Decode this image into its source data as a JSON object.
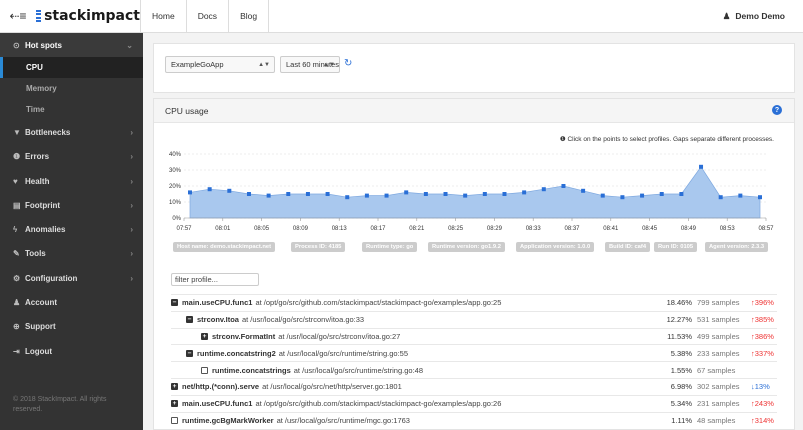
{
  "topbar": {
    "nav": [
      "Home",
      "Docs",
      "Blog"
    ],
    "user": "Demo Demo",
    "logo": "stackimpact"
  },
  "sidebar": {
    "items": [
      {
        "label": "Hot spots",
        "icon": "⊙",
        "open": true
      },
      {
        "label": "Bottlenecks",
        "icon": "▼"
      },
      {
        "label": "Errors",
        "icon": "❶"
      },
      {
        "label": "Health",
        "icon": "♥"
      },
      {
        "label": "Footprint",
        "icon": "▤"
      },
      {
        "label": "Anomalies",
        "icon": "ϟ"
      },
      {
        "label": "Tools",
        "icon": "✎"
      },
      {
        "label": "Configuration",
        "icon": "⚙"
      },
      {
        "label": "Account",
        "icon": "♟"
      },
      {
        "label": "Support",
        "icon": "⊕"
      },
      {
        "label": "Logout",
        "icon": "⇥"
      }
    ],
    "subitems": [
      "CPU",
      "Memory",
      "Time"
    ],
    "footer": "© 2018 StackImpact. All rights reserved."
  },
  "selectors": {
    "app": "ExampleGoApp",
    "range": "Last 60 minutes"
  },
  "panel": {
    "title": "CPU usage",
    "hint": "❶ Click on the points to select profiles. Gaps separate different processes."
  },
  "chart_data": {
    "type": "area",
    "x": [
      "07:57",
      "07:59",
      "08:01",
      "08:03",
      "08:05",
      "08:07",
      "08:09",
      "08:11",
      "08:13",
      "08:15",
      "08:17",
      "08:19",
      "08:21",
      "08:23",
      "08:25",
      "08:27",
      "08:29",
      "08:31",
      "08:33",
      "08:35",
      "08:37",
      "08:39",
      "08:41",
      "08:43",
      "08:45",
      "08:47",
      "08:49",
      "08:51",
      "08:53",
      "08:55"
    ],
    "values": [
      16,
      18,
      17,
      15,
      14,
      15,
      15,
      15,
      13,
      14,
      14,
      16,
      15,
      15,
      14,
      15,
      15,
      16,
      18,
      20,
      17,
      14,
      13,
      14,
      15,
      15,
      32,
      13,
      14,
      13
    ],
    "xticks": [
      "07:57",
      "08:01",
      "08:05",
      "08:09",
      "08:13",
      "08:17",
      "08:21",
      "08:25",
      "08:29",
      "08:33",
      "08:37",
      "08:41",
      "08:45",
      "08:49",
      "08:53",
      "08:57"
    ],
    "yticks": [
      "0%",
      "10%",
      "20%",
      "30%",
      "40%"
    ],
    "ylim": [
      0,
      40
    ],
    "color": "#2a6fd6"
  },
  "tags": [
    "Host name: demo.stackimpact.net",
    "Process ID: 4185",
    "Runtime type: go",
    "Runtime version: go1.9.2",
    "Application version: 1.0.0",
    "Build ID: caf4",
    "Run ID: 0105",
    "Agent version: 2.3.3"
  ],
  "filter_placeholder": "filter profile...",
  "profile": [
    {
      "depth": 0,
      "tog": "−",
      "fn": "main.useCPU.func1",
      "loc": "at /opt/go/src/github.com/stackimpact/stackimpact-go/examples/app.go:25",
      "pct": "18.46%",
      "pctv": 18.46,
      "samples": "799 samples",
      "chg": "↑396%"
    },
    {
      "depth": 1,
      "tog": "−",
      "fn": "strconv.Itoa",
      "loc": "at /usr/local/go/src/strconv/itoa.go:33",
      "pct": "12.27%",
      "pctv": 12.27,
      "samples": "531 samples",
      "chg": "↑385%"
    },
    {
      "depth": 2,
      "tog": "+",
      "fn": "strconv.FormatInt",
      "loc": "at /usr/local/go/src/strconv/itoa.go:27",
      "pct": "11.53%",
      "pctv": 11.53,
      "samples": "499 samples",
      "chg": "↑386%"
    },
    {
      "depth": 1,
      "tog": "−",
      "fn": "runtime.concatstring2",
      "loc": "at /usr/local/go/src/runtime/string.go:55",
      "pct": "5.38%",
      "pctv": 5.38,
      "samples": "233 samples",
      "chg": "↑337%"
    },
    {
      "depth": 2,
      "tog": "",
      "fn": "runtime.concatstrings",
      "loc": "at /usr/local/go/src/runtime/string.go:48",
      "pct": "1.55%",
      "pctv": 1.55,
      "samples": "67 samples",
      "chg": ""
    },
    {
      "depth": 0,
      "tog": "+",
      "fn": "net/http.(*conn).serve",
      "loc": "at /usr/local/go/src/net/http/server.go:1801",
      "pct": "6.98%",
      "pctv": 6.98,
      "samples": "302 samples",
      "chg": "↓13%",
      "down": true
    },
    {
      "depth": 0,
      "tog": "+",
      "fn": "main.useCPU.func1",
      "loc": "at /opt/go/src/github.com/stackimpact/stackimpact-go/examples/app.go:26",
      "pct": "5.34%",
      "pctv": 5.34,
      "samples": "231 samples",
      "chg": "↑243%"
    },
    {
      "depth": 0,
      "tog": "",
      "fn": "runtime.gcBgMarkWorker",
      "loc": "at /usr/local/go/src/runtime/mgc.go:1763",
      "pct": "1.11%",
      "pctv": 1.11,
      "samples": "48 samples",
      "chg": "↑314%"
    }
  ]
}
